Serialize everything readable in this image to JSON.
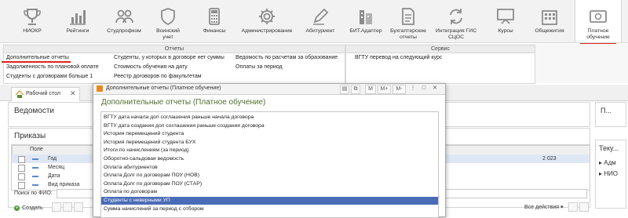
{
  "ribbon": [
    {
      "label": "",
      "icon": "main-icon"
    },
    {
      "label": "НИОКР",
      "icon": "trophy-icon"
    },
    {
      "label": "Рейтинги",
      "icon": "bar-chart-icon"
    },
    {
      "label": "Студпрофком",
      "icon": "people-icon"
    },
    {
      "label": "Воинский учет",
      "icon": "shield-icon"
    },
    {
      "label": "Финансы",
      "icon": "calculator-icon"
    },
    {
      "label": "Администрирование",
      "icon": "gear-icon"
    },
    {
      "label": "Абитуриент",
      "icon": "pen-icon"
    },
    {
      "label": "БИТ.Адаптер",
      "icon": "building-icon"
    },
    {
      "label": "Бухгалтерские отчеты",
      "icon": "report-icon"
    },
    {
      "label": "Интеграция ГИС СЦОС",
      "icon": "sync-icon"
    },
    {
      "label": "Курсы",
      "icon": "board-icon"
    },
    {
      "label": "Общежития",
      "icon": "dormitory-icon"
    },
    {
      "label": "Платное обучение",
      "icon": "money-icon"
    }
  ],
  "submenu": {
    "reports_title": "Отчеты",
    "service_title": "Сервис",
    "col1": [
      "Дополнительные отчеты",
      "Задолженность по плановой оплате",
      "Студенты с договорами больше 1"
    ],
    "col2": [
      "Студенты, у которых в договоре нет суммы",
      "Стоимость обучения на дату",
      "Реестр договоров по факультетам"
    ],
    "col3": [
      "Ведомость по расчетам за образование",
      "Оплаты за период"
    ],
    "service": [
      "ВГТУ перевод на следующий курс"
    ]
  },
  "tab": {
    "label": "Рабочий стол"
  },
  "workspace": {
    "statements_title": "Ведомости",
    "orders_title": "Приказы",
    "field_header": "Поле",
    "fields": [
      "Год",
      "Месяц",
      "Дата",
      "Вид приказа"
    ],
    "year_value": "2 023",
    "search_label": "Поиск по ФИО:",
    "create_label": "Создать",
    "all_actions": "Все действия",
    "right_p": "П...",
    "right_tek": "Теку...",
    "right_items": [
      "Адм",
      "НИО"
    ]
  },
  "dialog": {
    "window_title": "Дополнительные отчеты (Платное обучение)",
    "title": "Дополнительные отчеты (Платное обучение)",
    "toolbar": [
      "M",
      "M+",
      "M-"
    ],
    "items": [
      "ВГТУ дата начала доп соглашения раньше начала договора",
      "ВГТУ дата создания доп соглашения раньше создания договора",
      "История перемещений студента",
      "История перемещений студента БУХ",
      "Итоги по начислениям (за период)",
      "Оборотно-сальдовая ведомость",
      "Оплата абитуриентов",
      "Оплата Долг по договорам ПОУ (НОВ)",
      "Оплата Долг по договорам ПОУ (СТАР)",
      "Оплата по договорам",
      "Студенты с неверными УП",
      "Сумма начислений за период с отбором"
    ],
    "selected_index": 10
  },
  "colors": {
    "accent_red": "#e0241c",
    "selection": "#4a6cb6",
    "title_green": "#4e6e2e"
  }
}
